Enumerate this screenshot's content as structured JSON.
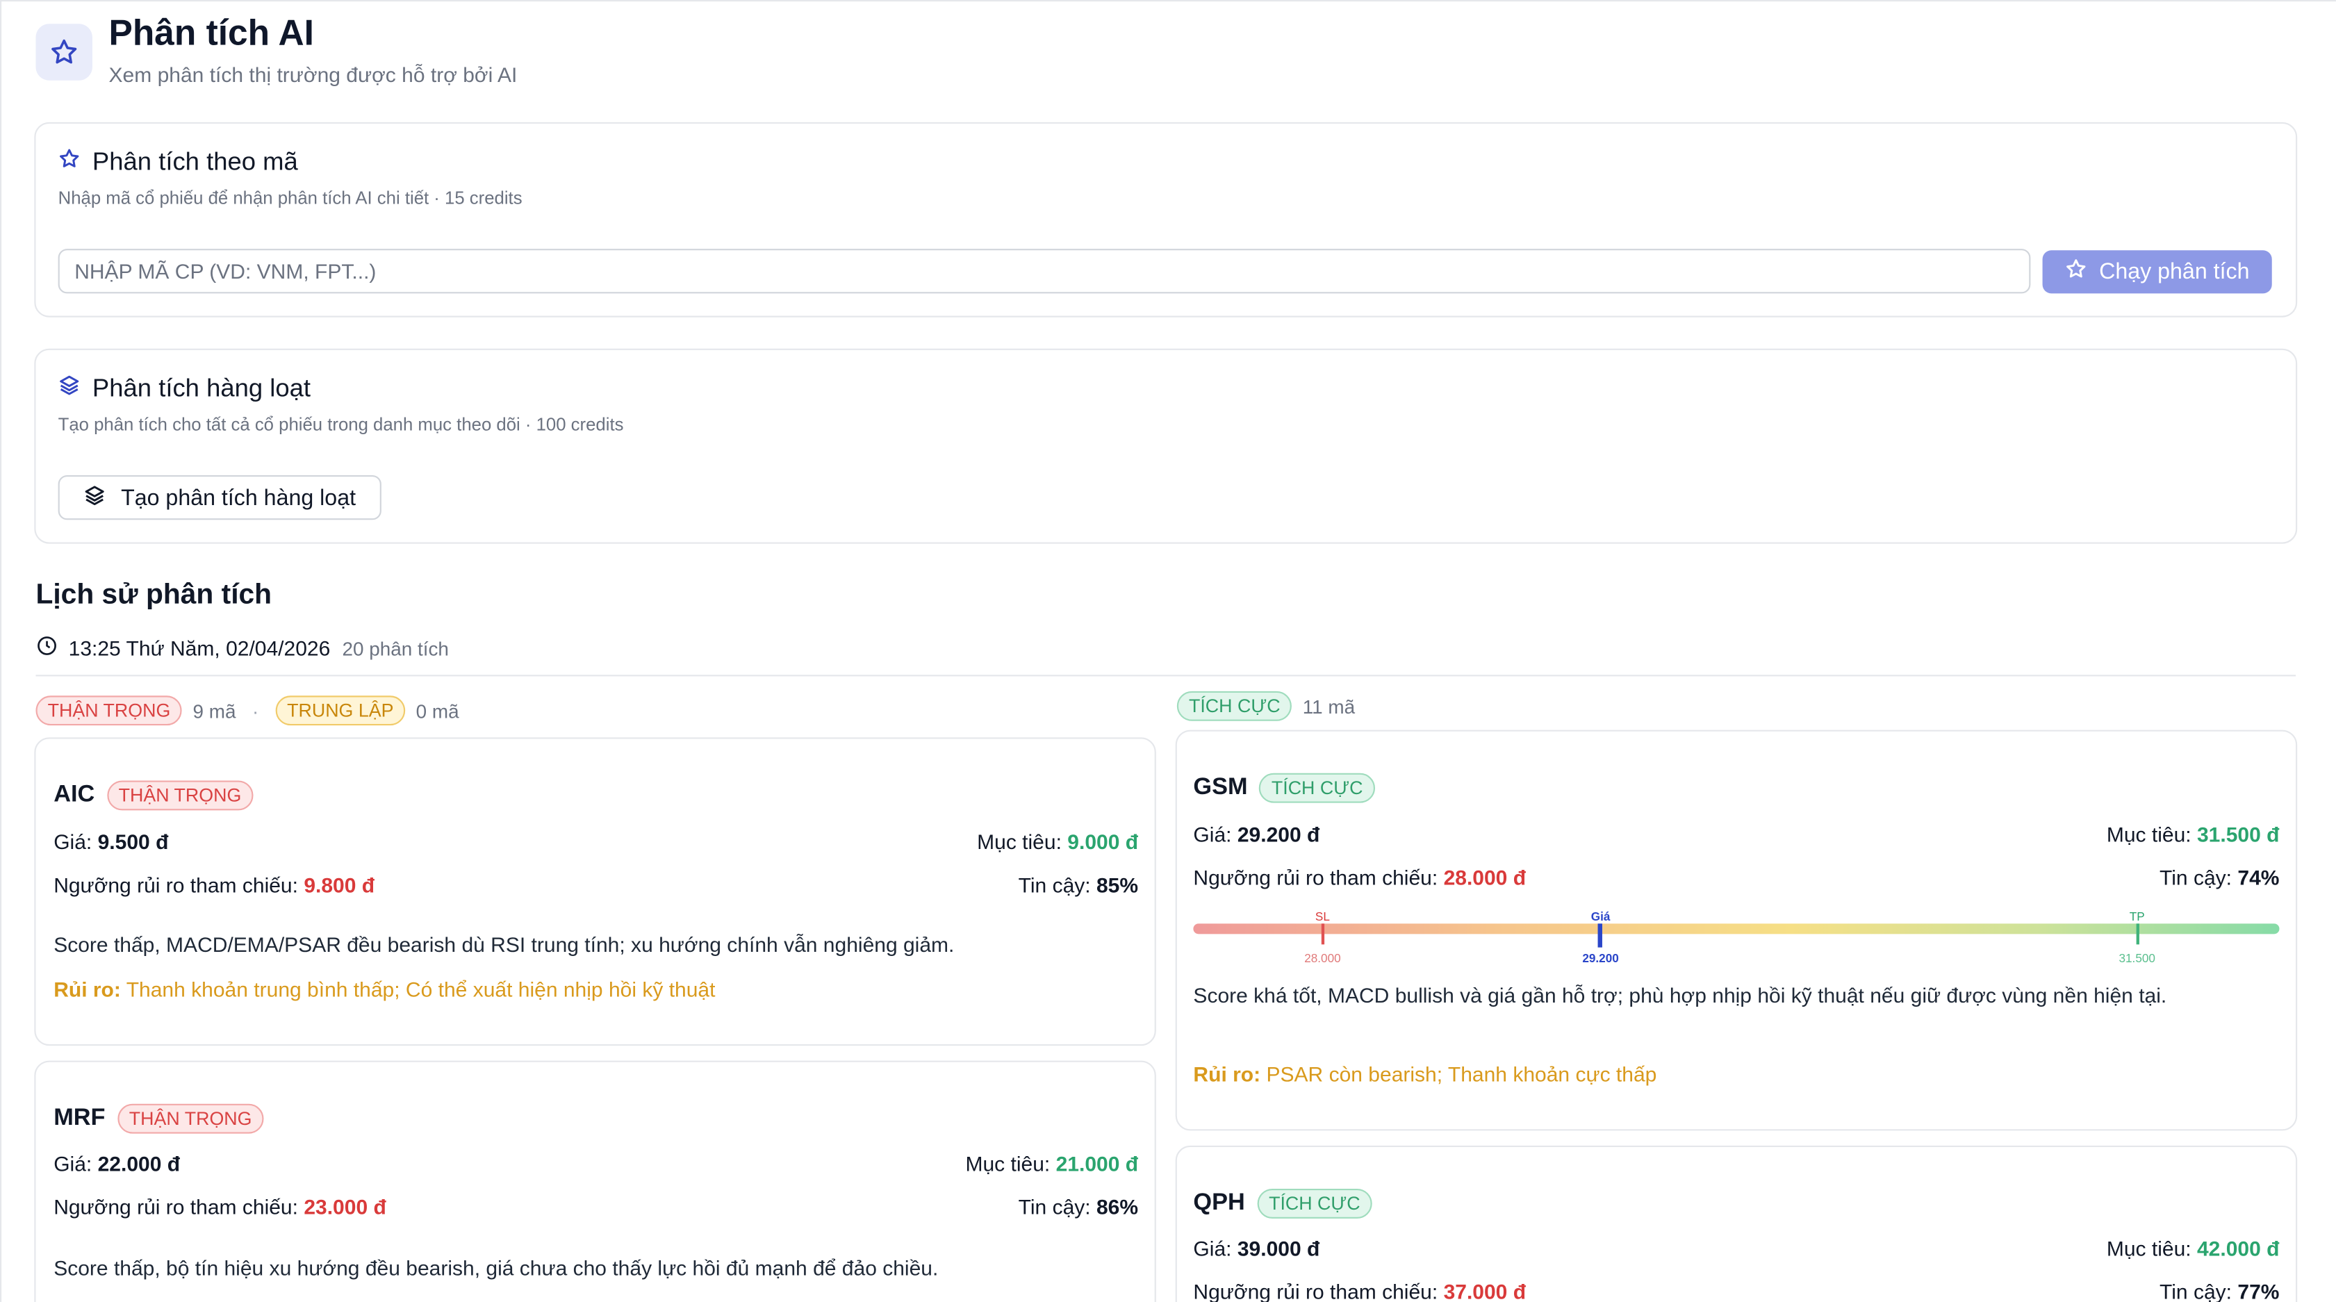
{
  "header": {
    "title": "Phân tích AI",
    "subtitle": "Xem phân tích thị trường được hỗ trợ bởi AI"
  },
  "by_symbol": {
    "title": "Phân tích theo mã",
    "subtitle": "Nhập mã cổ phiếu để nhận phân tích AI chi tiết · 15 credits",
    "input_placeholder": "NHẬP MÃ CP (VD: VNM, FPT...)",
    "input_value": "",
    "run_label": "Chạy phân tích"
  },
  "batch": {
    "title": "Phân tích hàng loạt",
    "subtitle": "Tạo phân tích cho tất cả cổ phiếu trong danh mục theo dõi · 100 credits",
    "button_label": "Tạo phân tích hàng loạt"
  },
  "history": {
    "title": "Lịch sử phân tích",
    "timestamp": "13:25 Thứ Năm, 02/04/2026",
    "count": "20 phân tích",
    "groups": {
      "cautious": {
        "label": "THẬN TRỌNG",
        "count": "9 mã"
      },
      "separator": "·",
      "neutral": {
        "label": "TRUNG LẬP",
        "count": "0 mã"
      },
      "positive": {
        "label": "TÍCH CỰC",
        "count": "11 mã"
      }
    },
    "labels": {
      "price": "Giá:",
      "target": "Mục tiêu:",
      "risk_ref": "Ngưỡng rủi ro tham chiếu:",
      "confidence": "Tin cậy:",
      "risk": "Rủi ro:"
    },
    "cards": {
      "aic": {
        "symbol": "AIC",
        "badge": "THẬN TRỌNG",
        "price": "9.500 đ",
        "target": "9.000 đ",
        "risk_ref": "9.800 đ",
        "confidence": "85%",
        "note": "Score thấp, MACD/EMA/PSAR đều bearish dù RSI trung tính; xu hướng chính vẫn nghiêng giảm.",
        "risk": "Thanh khoản trung bình thấp; Có thể xuất hiện nhịp hồi kỹ thuật"
      },
      "mrf": {
        "symbol": "MRF",
        "badge": "THẬN TRỌNG",
        "price": "22.000 đ",
        "target": "21.000 đ",
        "risk_ref": "23.000 đ",
        "confidence": "86%",
        "note": "Score thấp, bộ tín hiệu xu hướng đều bearish, giá chưa cho thấy lực hồi đủ mạnh để đảo chiều."
      },
      "gsm": {
        "symbol": "GSM",
        "badge": "TÍCH CỰC",
        "price": "29.200 đ",
        "target": "31.500 đ",
        "risk_ref": "28.000 đ",
        "confidence": "74%",
        "bar": {
          "sl_label": "SL",
          "sl_value": "28.000",
          "price_label": "Giá",
          "price_value": "29.200",
          "tp_label": "TP",
          "tp_value": "31.500",
          "price_fraction": 0.375,
          "sl_fraction": 0.119,
          "tp_fraction": 0.869
        },
        "note": "Score khá tốt, MACD bullish và giá gần hỗ trợ; phù hợp nhịp hồi kỹ thuật nếu giữ được vùng nền hiện tại.",
        "risk": "PSAR còn bearish; Thanh khoản cực thấp"
      },
      "qph": {
        "symbol": "QPH",
        "badge": "TÍCH CỰC",
        "price": "39.000 đ",
        "target": "42.000 đ",
        "risk_ref": "37.000 đ",
        "confidence": "77%"
      }
    }
  },
  "colors": {
    "accent": "#8d99e6",
    "icon": "#3346c2",
    "cautious": "#d94242",
    "neutral": "#c8860a",
    "positive": "#2f9e6a",
    "risk_text": "#d99a1d"
  }
}
